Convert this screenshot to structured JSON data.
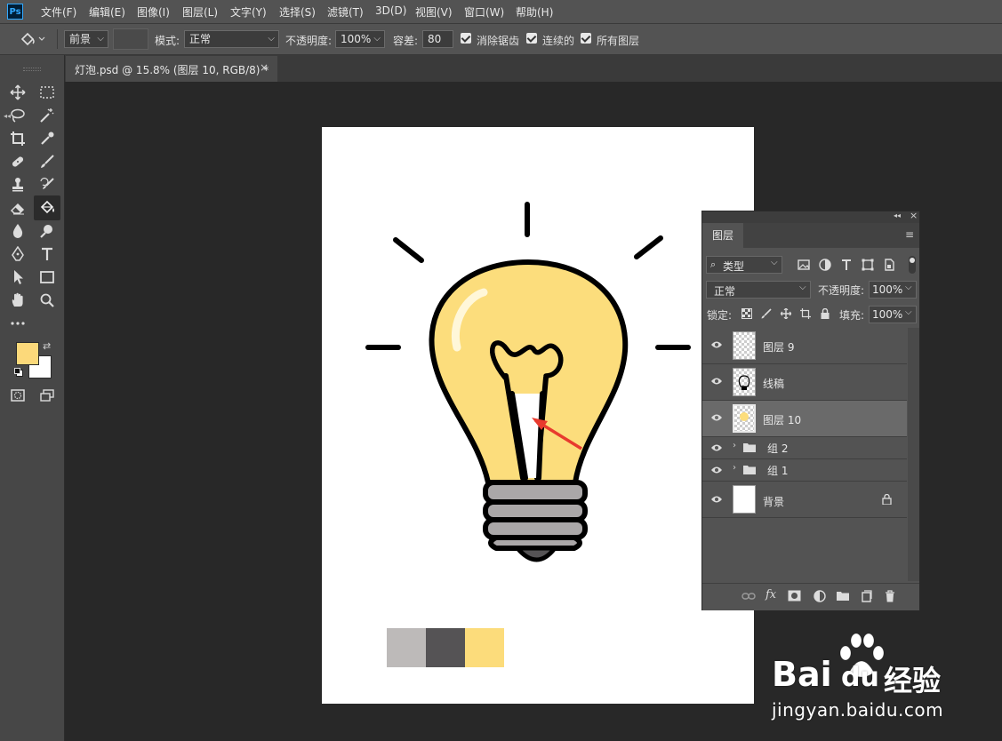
{
  "app": {
    "logo": "Ps"
  },
  "menu": [
    "文件(F)",
    "编辑(E)",
    "图像(I)",
    "图层(L)",
    "文字(Y)",
    "选择(S)",
    "滤镜(T)",
    "3D(D)",
    "视图(V)",
    "窗口(W)",
    "帮助(H)"
  ],
  "options": {
    "fill_source": "前景",
    "mode_label": "模式:",
    "mode_value": "正常",
    "opacity_label": "不透明度:",
    "opacity_value": "100%",
    "tolerance_label": "容差:",
    "tolerance_value": "80",
    "antialias_label": "消除锯齿",
    "contiguous_label": "连续的",
    "all_layers_label": "所有图层",
    "antialias_checked": true,
    "contiguous_checked": true,
    "all_layers_checked": true
  },
  "document": {
    "tab_title": "灯泡.psd @ 15.8% (图层 10, RGB/8) *",
    "close": "×"
  },
  "colors": {
    "foreground": "#fcd97a",
    "background": "#ffffff",
    "bulb_fill": "#fcdd7c",
    "base_fill": "#aaa7a8"
  },
  "swatches": [
    "#bdbab9",
    "#555355",
    "#fcdc7b"
  ],
  "layers_panel": {
    "tab": "图层",
    "filter_kind": "类型",
    "blend_mode": "正常",
    "opacity_label": "不透明度:",
    "opacity_value": "100%",
    "lock_label": "锁定:",
    "fill_label": "填充:",
    "fill_value": "100%",
    "layers": [
      {
        "name": "图层 9",
        "type": "layer",
        "selected": false
      },
      {
        "name": "线稿",
        "type": "layer",
        "selected": false
      },
      {
        "name": "图层 10",
        "type": "layer",
        "selected": true
      },
      {
        "name": "组 2",
        "type": "group",
        "selected": false
      },
      {
        "name": "组 1",
        "type": "group",
        "selected": false
      },
      {
        "name": "背景",
        "type": "background",
        "selected": false,
        "locked": true
      }
    ]
  },
  "watermark": {
    "brand": "Bai",
    "brand_suffix": "du",
    "cn": "经验",
    "url": "jingyan.baidu.com"
  }
}
